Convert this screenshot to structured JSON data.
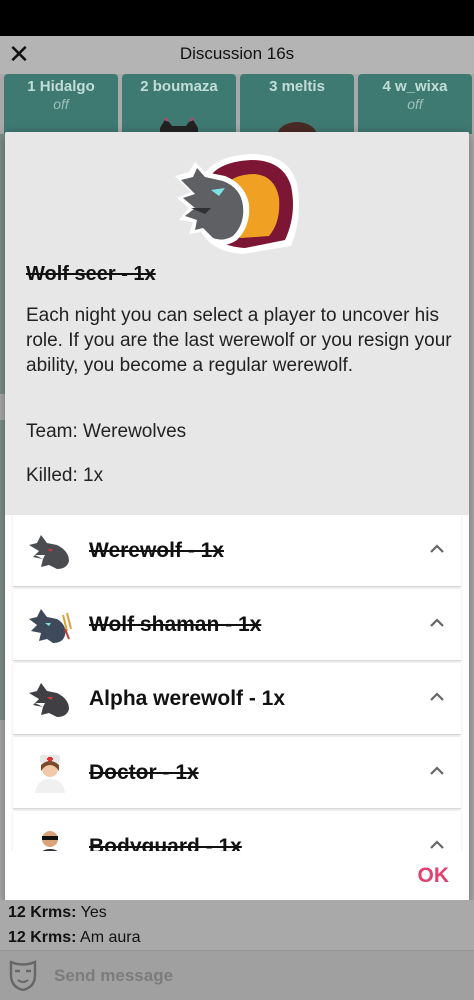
{
  "header": {
    "title": "Discussion 16s"
  },
  "players": [
    {
      "label": "1 Hidalgo",
      "status": "off"
    },
    {
      "label": "2 boumaza",
      "status": ""
    },
    {
      "label": "3 meltis",
      "status": ""
    },
    {
      "label": "4 w_wixa",
      "status": "off"
    }
  ],
  "role_detail": {
    "title": "Wolf seer -  1x",
    "description": "Each night you can select a player to uncover his role. If you are the last werewolf or you resign your ability, you become a regular werewolf.",
    "team": "Team: Werewolves",
    "killed": "Killed: 1x"
  },
  "roles": [
    {
      "name": "Werewolf -  1x",
      "struck": true,
      "icon": "werewolf-icon"
    },
    {
      "name": "Wolf shaman -  1x",
      "struck": true,
      "icon": "wolf-shaman-icon"
    },
    {
      "name": "Alpha werewolf -  1x",
      "struck": false,
      "icon": "alpha-werewolf-icon"
    },
    {
      "name": "Doctor -  1x",
      "struck": true,
      "icon": "doctor-icon"
    },
    {
      "name": "Bodyguard -  1x",
      "struck": true,
      "icon": "bodyguard-icon"
    }
  ],
  "dialog": {
    "ok_label": "OK"
  },
  "chat": [
    {
      "author": "12 Krms:",
      "text": " Yes"
    },
    {
      "author": "12 Krms:",
      "text": " Am aura"
    }
  ],
  "input": {
    "placeholder": "Send message"
  },
  "colors": {
    "accent": "#e2416f",
    "tile": "#3f7a72",
    "dialog_top": "#e7e7e7"
  }
}
